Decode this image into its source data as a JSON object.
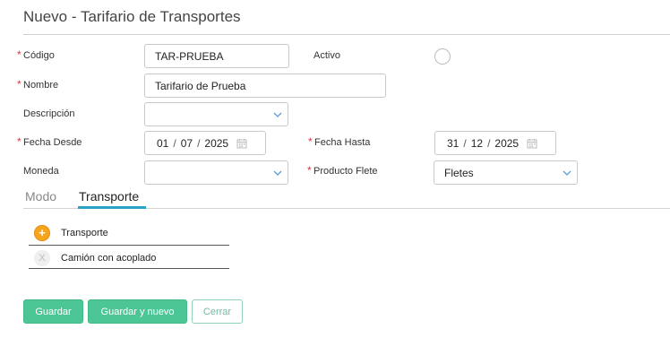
{
  "header": {
    "title": "Nuevo - Tarifario de Transportes"
  },
  "form": {
    "codigo": {
      "label": "Código",
      "value": "TAR-PRUEBA"
    },
    "activo": {
      "label": "Activo"
    },
    "nombre": {
      "label": "Nombre",
      "value": "Tarifario de Prueba"
    },
    "descripcion": {
      "label": "Descripción",
      "value": ""
    },
    "fecha_desde": {
      "label": "Fecha Desde",
      "day": "01",
      "month": "07",
      "year": "2025"
    },
    "fecha_hasta": {
      "label": "Fecha Hasta",
      "day": "31",
      "month": "12",
      "year": "2025"
    },
    "moneda": {
      "label": "Moneda",
      "value": ""
    },
    "producto_flete": {
      "label": "Producto Flete",
      "value": "Fletes"
    },
    "required_mark": "*",
    "date_sep": "/"
  },
  "tabs": [
    {
      "label": "Modo",
      "active": false
    },
    {
      "label": "Transporte",
      "active": true
    }
  ],
  "transport_list": {
    "header_label": "Transporte",
    "items": [
      {
        "label": "Camión con acoplado"
      }
    ],
    "add_icon": "plus",
    "remove_icon": "X"
  },
  "buttons": {
    "save": "Guardar",
    "save_new": "Guardar y nuevo",
    "close": "Cerrar"
  },
  "colors": {
    "accent": "#2aa3c6",
    "primary_button": "#4cc694",
    "required": "#d9343f",
    "add_icon": "#f4a51c"
  }
}
